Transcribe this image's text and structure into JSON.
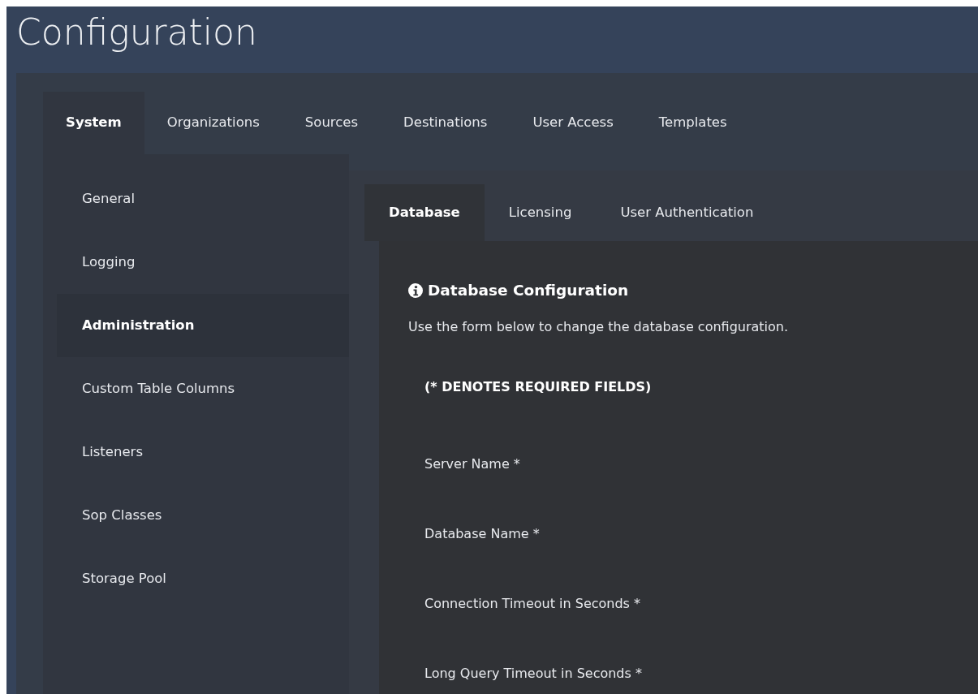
{
  "page_title": "Configuration",
  "tabs": [
    {
      "label": "System",
      "selected": true
    },
    {
      "label": "Organizations",
      "selected": false
    },
    {
      "label": "Sources",
      "selected": false
    },
    {
      "label": "Destinations",
      "selected": false
    },
    {
      "label": "User Access",
      "selected": false
    },
    {
      "label": "Templates",
      "selected": false
    }
  ],
  "sidebar": {
    "items": [
      {
        "label": "General",
        "selected": false
      },
      {
        "label": "Logging",
        "selected": false
      },
      {
        "label": "Administration",
        "selected": true
      },
      {
        "label": "Custom Table Columns",
        "selected": false
      },
      {
        "label": "Listeners",
        "selected": false
      },
      {
        "label": "Sop Classes",
        "selected": false
      },
      {
        "label": "Storage Pool",
        "selected": false
      }
    ]
  },
  "sub_tabs": [
    {
      "label": "Database",
      "selected": true
    },
    {
      "label": "Licensing",
      "selected": false
    },
    {
      "label": "User Authentication",
      "selected": false
    }
  ],
  "section": {
    "title": "Database Configuration",
    "description": "Use the form below to change the database configuration.",
    "required_note": "(* DENOTES REQUIRED FIELDS)",
    "fields": [
      {
        "label": "Server Name *"
      },
      {
        "label": "Database Name *"
      },
      {
        "label": "Connection Timeout in Seconds *"
      },
      {
        "label": "Long Query Timeout in Seconds *"
      }
    ]
  }
}
